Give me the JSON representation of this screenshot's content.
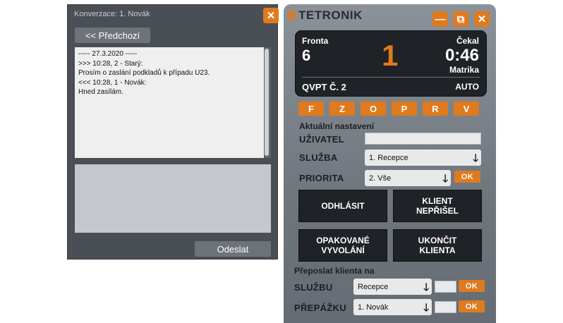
{
  "conversation": {
    "title": "Konverzace: 1. Novák",
    "prev_label": "<< Předchozí",
    "send_label": "Odeslat",
    "messages": [
      "----- 27.3.2020 -----",
      ">>> 10:28, 2 - Starý:",
      "Prosím o zaslání podkladů k případu U23.",
      "<<< 10:28, 1 - Novák:",
      "Hned zasílám."
    ]
  },
  "panel": {
    "logo": "TETRONIK",
    "display": {
      "queue_label": "Fronta",
      "queue_value": "6",
      "current_number": "1",
      "wait_label": "Čekal",
      "wait_value": "0:46",
      "sub_label": "Matrika",
      "counter_label": "QVPT Č. 2",
      "mode": "AUTO"
    },
    "letters": [
      "F",
      "Z",
      "O",
      "P",
      "R",
      "V"
    ],
    "settings": {
      "section_label": "Aktuální nastavení",
      "user_label": "UŽIVATEL",
      "service_label": "SLUŽBA",
      "service_value": "1. Recepce",
      "priority_label": "PRIORITA",
      "priority_value": "2. Vše",
      "ok_label": "OK"
    },
    "actions": {
      "logout": "ODHLÁSIT",
      "no_show": "KLIENT\nNEPŘIŠEL",
      "recall": "OPAKOVANÉ\nVYVOLÁNÍ",
      "finish": "UKONČIT\nKLIENTA"
    },
    "forward": {
      "section_label": "Přeposlat klienta na",
      "service_label": "SLUŽBU",
      "service_value": "Recepce",
      "desk_label": "PŘEPÁŽKU",
      "desk_value": "1. Novák",
      "ok_label": "OK"
    }
  },
  "icons": {
    "close": "✕",
    "minimize": "—",
    "restore": "⧉",
    "arrow_down": "🡓"
  },
  "colors": {
    "accent": "#e07a1e",
    "dark": "#1f2226"
  }
}
